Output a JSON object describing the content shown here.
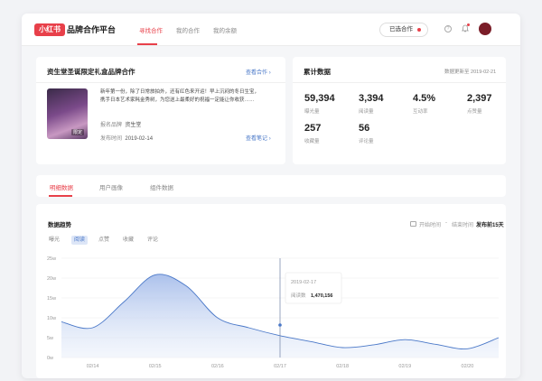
{
  "header": {
    "logo": "小红书",
    "title": "品牌合作平台",
    "nav": [
      "寻找合作",
      "我的合作",
      "我的余额"
    ],
    "cooperate_btn": "已选合作"
  },
  "product": {
    "title": "资生堂圣诞限定礼盒品牌合作",
    "link": "查看合作",
    "image_tag": "限定",
    "description": "新年第一份，除了日常旅拍外，还有红色来开运！早上沉闷的冬日生宝，携手日本艺术家耗金秀树，为您送上最柔好的祝福一定能让你收获……",
    "brand_label": "报名品牌",
    "brand_value": "资生堂",
    "time_label": "发布时间",
    "time_value": "2019-02-14",
    "note_link": "查看笔记"
  },
  "stats": {
    "title": "累计数据",
    "updated": "数据更新至 2019-02-21",
    "items": [
      {
        "value": "59,394",
        "label": "曝光量"
      },
      {
        "value": "3,394",
        "label": "阅读量"
      },
      {
        "value": "4.5%",
        "label": "互动率"
      },
      {
        "value": "2,397",
        "label": "点赞量"
      },
      {
        "value": "257",
        "label": "收藏量"
      },
      {
        "value": "56",
        "label": "评论量"
      }
    ]
  },
  "tabs": [
    "明细数据",
    "用户画像",
    "组件数据"
  ],
  "chart_panel": {
    "title": "数据趋势",
    "chips": [
      "曝光",
      "阅读",
      "点赞",
      "收藏",
      "评论"
    ],
    "active_chip": 1,
    "start_placeholder": "开始时间",
    "separator": "-",
    "end_placeholder": "结束时间",
    "range_label": "发布前15天"
  },
  "chart_data": {
    "type": "area",
    "series": [
      {
        "name": "阅读数",
        "x": [
          "02/13.5",
          "02/14",
          "02/14.5",
          "02/15",
          "02/15.5",
          "02/16",
          "02/16.5",
          "02/17",
          "02/17.5",
          "02/18",
          "02/18.5",
          "02/19",
          "02/19.5",
          "02/20",
          "02/20.5"
        ],
        "values": [
          9,
          7.5,
          14,
          20.8,
          18,
          10,
          7.5,
          5.5,
          4,
          2.5,
          3.2,
          4.5,
          3.3,
          2.2,
          5
        ]
      }
    ],
    "x_ticks": [
      "02/14",
      "02/15",
      "02/16",
      "02/17",
      "02/18",
      "02/19",
      "02/20"
    ],
    "y_ticks": [
      "0w",
      "5w",
      "10w",
      "15w",
      "20w",
      "25w"
    ],
    "ylim": [
      0,
      25
    ],
    "tooltip": {
      "date": "2019-02-17",
      "label": "阅读数",
      "value": "1,470,156"
    },
    "accent": "#4a78c8"
  },
  "colors": {
    "brand": "#e8404a",
    "accent": "#4a78c8"
  }
}
